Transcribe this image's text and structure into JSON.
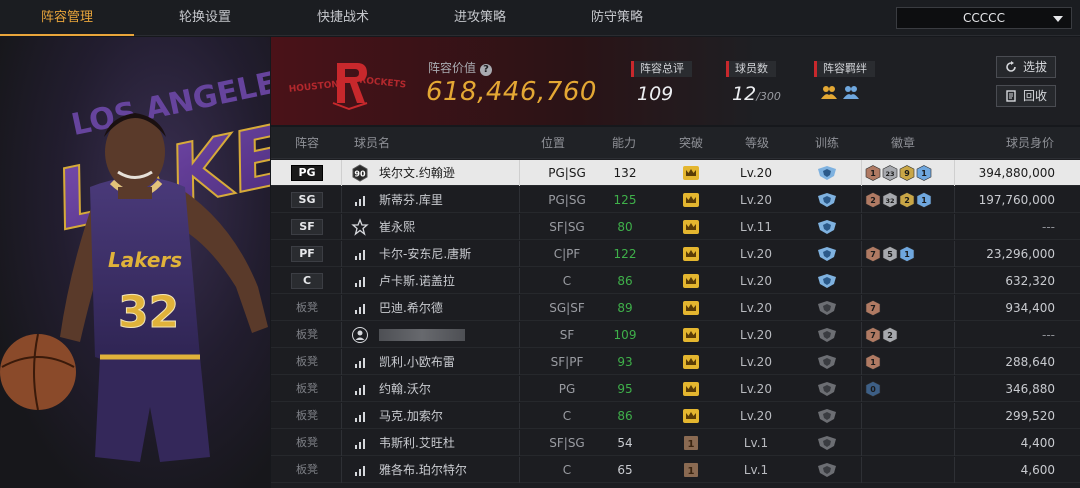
{
  "nav": {
    "tabs": [
      "阵容管理",
      "轮换设置",
      "快捷战术",
      "进攻策略",
      "防守策略"
    ],
    "active_index": 0,
    "team_select_value": "CCCCC"
  },
  "header": {
    "lineup_value_label": "阵容价值",
    "lineup_value": "618,446,760",
    "rating_label": "阵容总评",
    "rating_value": "109",
    "players_label": "球员数",
    "players_value": "12",
    "players_max": "/300",
    "bond_label": "阵容羁绊",
    "draft_button": "选拔",
    "recycle_button": "回收",
    "accent_color": "#e4a834",
    "team_color": "#c8282c"
  },
  "table": {
    "headers": [
      "阵容",
      "球员名",
      "位置",
      "能力",
      "突破",
      "等级",
      "训练",
      "徽章",
      "球员身价"
    ],
    "rows": [
      {
        "slot": "PG",
        "starter": true,
        "icon": "rating-90-icon",
        "icon_text": "90",
        "name": "埃尔文.约翰逊",
        "position": "PG|SG",
        "ability": "132",
        "ability_green": false,
        "break": "crown",
        "level": "Lv.20",
        "train": "blue",
        "badges": [
          "1",
          "23",
          "9",
          "1"
        ],
        "badge_colors": [
          "#b07a63",
          "#a7a9ae",
          "#c9a646",
          "#6fa7de"
        ],
        "value": "394,880,000"
      },
      {
        "slot": "SG",
        "starter": true,
        "icon": "signal-icon",
        "icon_text": "",
        "name": "斯蒂芬.库里",
        "position": "PG|SG",
        "ability": "125",
        "ability_green": true,
        "break": "crown",
        "level": "Lv.20",
        "train": "blue",
        "badges": [
          "2",
          "32",
          "2",
          "1"
        ],
        "badge_colors": [
          "#b07a63",
          "#a7a9ae",
          "#c9a646",
          "#6fa7de"
        ],
        "value": "197,760,000"
      },
      {
        "slot": "SF",
        "starter": true,
        "icon": "star-icon",
        "icon_text": "",
        "name": "崔永熙",
        "position": "SF|SG",
        "ability": "80",
        "ability_green": true,
        "break": "crown",
        "level": "Lv.11",
        "train": "blue",
        "badges": [],
        "badge_colors": [],
        "value": "---"
      },
      {
        "slot": "PF",
        "starter": true,
        "icon": "signal-icon",
        "icon_text": "",
        "name": "卡尔-安东尼.唐斯",
        "position": "C|PF",
        "ability": "122",
        "ability_green": true,
        "break": "crown",
        "level": "Lv.20",
        "train": "blue",
        "badges": [
          "7",
          "5",
          "1"
        ],
        "badge_colors": [
          "#b07a63",
          "#a7a9ae",
          "#6fa7de"
        ],
        "value": "23,296,000"
      },
      {
        "slot": "C",
        "starter": true,
        "icon": "signal-icon",
        "icon_text": "",
        "name": "卢卡斯.诺盖拉",
        "position": "C",
        "ability": "86",
        "ability_green": true,
        "break": "crown",
        "level": "Lv.20",
        "train": "blue",
        "badges": [],
        "badge_colors": [],
        "value": "632,320"
      },
      {
        "slot": "板凳",
        "starter": false,
        "icon": "signal-icon",
        "icon_text": "",
        "name": "巴迪.希尔德",
        "position": "SG|SF",
        "ability": "89",
        "ability_green": true,
        "break": "crown",
        "level": "Lv.20",
        "train": "gray",
        "badges": [
          "7"
        ],
        "badge_colors": [
          "#b07a63"
        ],
        "value": "934,400"
      },
      {
        "slot": "板凳",
        "starter": false,
        "icon": "user-icon",
        "icon_text": "",
        "name": "",
        "blurred": true,
        "position": "SF",
        "ability": "109",
        "ability_green": true,
        "break": "crown",
        "level": "Lv.20",
        "train": "gray",
        "badges": [
          "7",
          "2"
        ],
        "badge_colors": [
          "#b07a63",
          "#a7a9ae"
        ],
        "value": "---"
      },
      {
        "slot": "板凳",
        "starter": false,
        "icon": "signal-icon",
        "icon_text": "",
        "name": "凯利.小欧布雷",
        "position": "SF|PF",
        "ability": "93",
        "ability_green": true,
        "break": "crown",
        "level": "Lv.20",
        "train": "gray",
        "badges": [
          "1"
        ],
        "badge_colors": [
          "#b07a63"
        ],
        "value": "288,640"
      },
      {
        "slot": "板凳",
        "starter": false,
        "icon": "signal-icon",
        "icon_text": "",
        "name": "约翰.沃尔",
        "position": "PG",
        "ability": "95",
        "ability_green": true,
        "break": "crown",
        "level": "Lv.20",
        "train": "gray",
        "badges": [
          "0"
        ],
        "badge_colors": [
          "#3d5f86"
        ],
        "value": "346,880"
      },
      {
        "slot": "板凳",
        "starter": false,
        "icon": "signal-icon",
        "icon_text": "",
        "name": "马克.加索尔",
        "position": "C",
        "ability": "86",
        "ability_green": true,
        "break": "crown",
        "level": "Lv.20",
        "train": "gray",
        "badges": [],
        "badge_colors": [],
        "value": "299,520"
      },
      {
        "slot": "板凳",
        "starter": false,
        "icon": "signal-icon",
        "icon_text": "",
        "name": "韦斯利.艾旺杜",
        "position": "SF|SG",
        "ability": "54",
        "ability_green": false,
        "break": "1",
        "level": "Lv.1",
        "train": "gray",
        "badges": [],
        "badge_colors": [],
        "value": "4,400"
      },
      {
        "slot": "板凳",
        "starter": false,
        "icon": "signal-icon",
        "icon_text": "",
        "name": "雅各布.珀尔特尔",
        "position": "C",
        "ability": "65",
        "ability_green": false,
        "break": "1",
        "level": "Lv.1",
        "train": "gray",
        "badges": [],
        "badge_colors": [],
        "value": "4,600"
      }
    ]
  }
}
